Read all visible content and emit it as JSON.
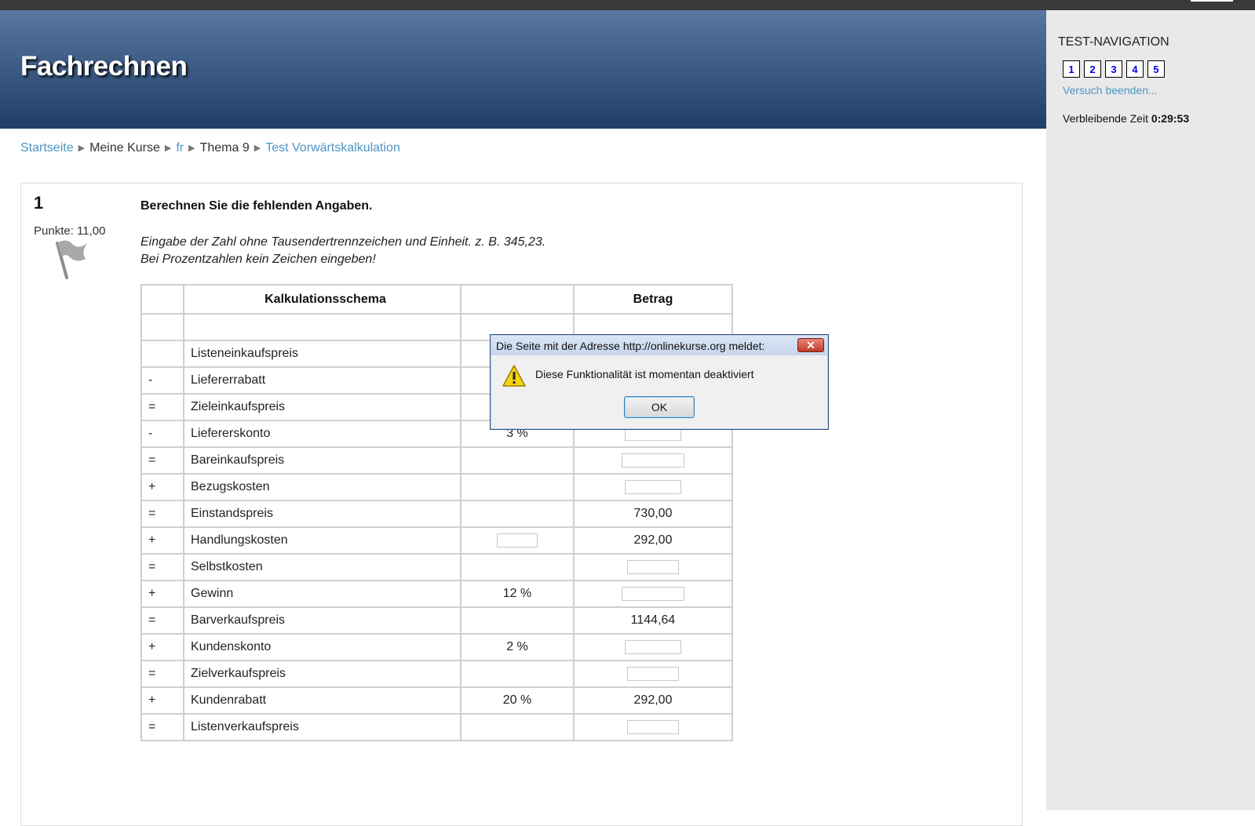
{
  "site": {
    "title": "Fachrechnen"
  },
  "breadcrumb": {
    "items": [
      "Startseite",
      "Meine Kurse",
      "fr",
      "Thema 9",
      "Test Vorwärtskalkulation"
    ]
  },
  "sidebar": {
    "title": "TEST-NAVIGATION",
    "buttons": [
      "1",
      "2",
      "3",
      "4",
      "5"
    ],
    "finish_link": "Versuch beenden...",
    "time_label": "Verbleibende Zeit",
    "time_value": "0:29:53"
  },
  "question": {
    "number": "1",
    "grade": "Punkte: 11,00",
    "title": "Berechnen Sie die fehlenden Angaben.",
    "hint_line1": "Eingabe der Zahl ohne Tausendertrennzeichen und Einheit. z. B. 345,23.",
    "hint_line2": "Bei Prozentzahlen kein Zeichen eingeben!"
  },
  "table": {
    "headers": [
      "",
      "Kalkulationsschema",
      "",
      "Betrag"
    ],
    "rows": [
      {
        "op": "",
        "label": "",
        "percent": "",
        "amount": ""
      },
      {
        "op": "",
        "label": "Listeneinkaufspreis",
        "percent": "",
        "amount": ""
      },
      {
        "op": "-",
        "label": "Liefererrabatt",
        "percent": "",
        "amount": ""
      },
      {
        "op": "=",
        "label": "Zieleinkaufspreis",
        "percent": "",
        "amount": ""
      },
      {
        "op": "-",
        "label": "Liefererskonto",
        "percent": "3 %",
        "amount": ""
      },
      {
        "op": "=",
        "label": "Bareinkaufspreis",
        "percent": "",
        "amount": ""
      },
      {
        "op": "+",
        "label": "Bezugskosten",
        "percent": "",
        "amount": ""
      },
      {
        "op": "=",
        "label": "Einstandspreis",
        "percent": "",
        "amount": "730,00"
      },
      {
        "op": "+",
        "label": "Handlungskosten",
        "percent": "",
        "amount": "292,00"
      },
      {
        "op": "=",
        "label": "Selbstkosten",
        "percent": "",
        "amount": ""
      },
      {
        "op": "+",
        "label": "Gewinn",
        "percent": "12 %",
        "amount": ""
      },
      {
        "op": "=",
        "label": "Barverkaufspreis",
        "percent": "",
        "amount": "1144,64"
      },
      {
        "op": "+",
        "label": "Kundenskonto",
        "percent": "2 %",
        "amount": ""
      },
      {
        "op": "=",
        "label": "Zielverkaufspreis",
        "percent": "",
        "amount": ""
      },
      {
        "op": "+",
        "label": "Kundenrabatt",
        "percent": "20 %",
        "amount": "292,00"
      },
      {
        "op": "=",
        "label": "Listenverkaufspreis",
        "percent": "",
        "amount": ""
      }
    ]
  },
  "dialog": {
    "title": "Die Seite mit der Adresse http://onlinekurse.org meldet:",
    "message": "Diese Funktionalität ist momentan deaktiviert",
    "ok_label": "OK",
    "close_symbol": "✕"
  },
  "colors": {
    "header_top": "#5877a0",
    "header_bottom": "#1f3e66",
    "link": "#4e95c3",
    "sidebar_bg": "#e9e9e9",
    "nav_button_text": "#0000ee"
  },
  "icons": {
    "flag": "flag-icon",
    "warning": "warning-icon",
    "breadcrumb_separator": "triangle-right-icon"
  }
}
